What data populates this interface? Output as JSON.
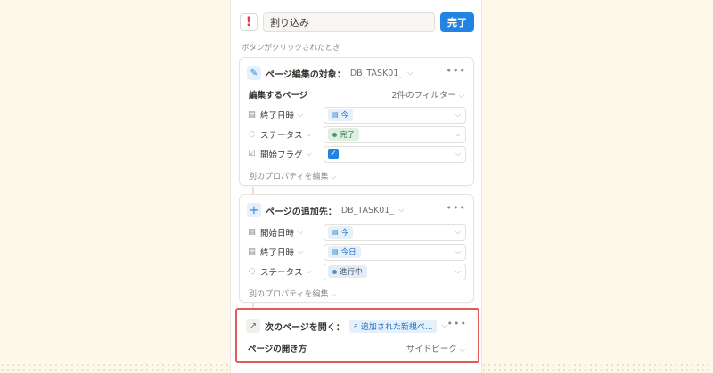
{
  "header": {
    "automation_name": "割り込み",
    "done_label": "完了",
    "trigger_caption": "ボタンがクリックされたとき"
  },
  "edit_card": {
    "title": "ページ編集の対象：",
    "database": "DB_TASK01_",
    "subheader_label": "編集するページ",
    "filter_label": "2件のフィルター",
    "properties": [
      {
        "name": "終了日時",
        "icon": "calendar-icon",
        "value": "今",
        "type": "date"
      },
      {
        "name": "ステータス",
        "icon": "status-icon",
        "value": "完了",
        "type": "status",
        "color": "#4f9768"
      },
      {
        "name": "開始フラグ",
        "icon": "checkbox-icon",
        "value": "",
        "type": "checkbox"
      }
    ],
    "edit_other": "別のプロパティを編集"
  },
  "add_card": {
    "title": "ページの追加先：",
    "database": "DB_TASK01_",
    "properties": [
      {
        "name": "開始日時",
        "icon": "calendar-icon",
        "value": "今",
        "type": "date"
      },
      {
        "name": "終了日時",
        "icon": "calendar-icon",
        "value": "今日",
        "type": "date"
      },
      {
        "name": "ステータス",
        "icon": "status-icon",
        "value": "進行中",
        "type": "status",
        "color": "#5b87c5"
      }
    ],
    "edit_other": "別のプロパティを編集"
  },
  "open_card": {
    "title": "次のページを開く：",
    "target": "追加された新規ペ...",
    "open_mode_label": "ページの開き方",
    "open_mode_value": "サイドピーク"
  },
  "colors": {
    "accent": "#2383e2",
    "highlight": "#e35a5a",
    "alert": "#e03e3e"
  }
}
